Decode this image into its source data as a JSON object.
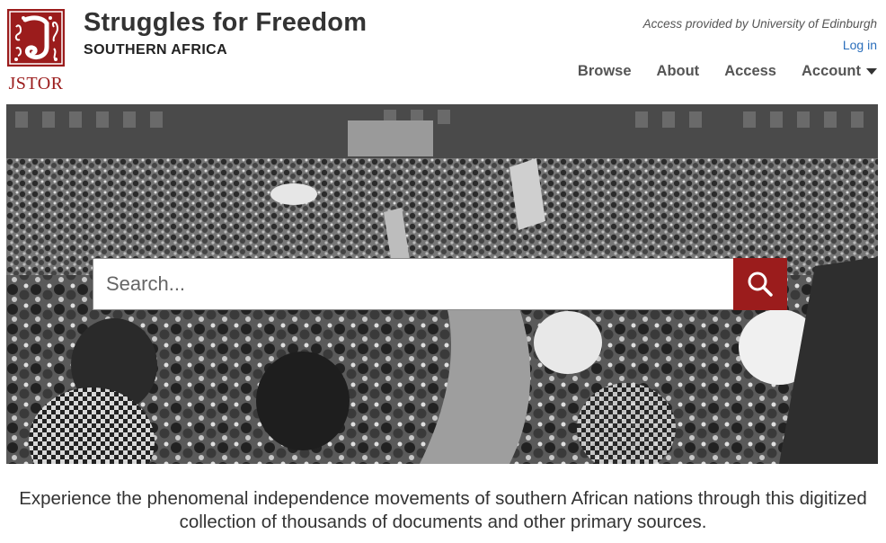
{
  "header": {
    "logo_text": "JSTOR",
    "title": "Struggles for Freedom",
    "subtitle": "SOUTHERN AFRICA",
    "access_note": "Access provided by University of Edinburgh",
    "login_label": "Log in"
  },
  "nav": {
    "items": [
      {
        "label": "Browse"
      },
      {
        "label": "About"
      },
      {
        "label": "Access"
      },
      {
        "label": "Account"
      }
    ]
  },
  "search": {
    "placeholder": "Search...",
    "value": ""
  },
  "tagline": "Experience the phenomenal independence movements of southern African nations through this digitized collection of thousands of documents and other primary sources.",
  "colors": {
    "brand_red": "#9b1c1c",
    "link_blue": "#2a6ebb"
  },
  "icons": {
    "search": "search-icon",
    "account_dropdown": "caret-down-icon",
    "logo": "jstor-logo-icon"
  }
}
